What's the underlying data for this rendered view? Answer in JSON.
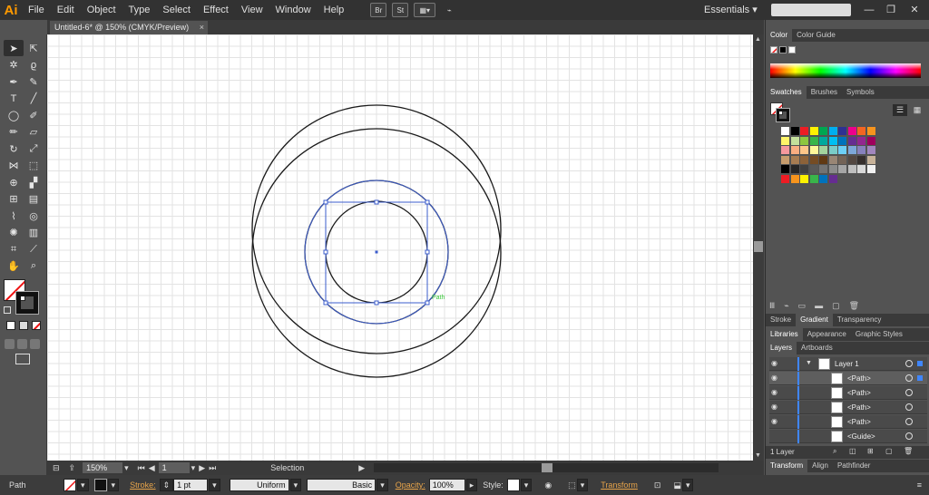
{
  "app": {
    "logo": "Ai",
    "workspace": "Essentials"
  },
  "menu": [
    "File",
    "Edit",
    "Object",
    "Type",
    "Select",
    "Effect",
    "View",
    "Window",
    "Help"
  ],
  "menubar_icons": [
    "br-icon",
    "st-icon",
    "arrange-icon",
    "gpu-icon"
  ],
  "menubar_icon_labels": [
    "Br",
    "St",
    "▦▾",
    "⌁"
  ],
  "window_controls": [
    "—",
    "❐",
    "✕"
  ],
  "document": {
    "tab_title": "Untitled-6* @ 150% (CMYK/Preview)",
    "close": "×"
  },
  "tools": [
    {
      "name": "selection-tool-icon",
      "glyph": "➤"
    },
    {
      "name": "direct-selection-tool-icon",
      "glyph": "⇱"
    },
    {
      "name": "magic-wand-tool-icon",
      "glyph": "✲"
    },
    {
      "name": "lasso-tool-icon",
      "glyph": "ϱ"
    },
    {
      "name": "pen-tool-icon",
      "glyph": "✒"
    },
    {
      "name": "curvature-tool-icon",
      "glyph": "✎"
    },
    {
      "name": "type-tool-icon",
      "glyph": "T"
    },
    {
      "name": "line-tool-icon",
      "glyph": "╱"
    },
    {
      "name": "ellipse-tool-icon",
      "glyph": "◯"
    },
    {
      "name": "paintbrush-tool-icon",
      "glyph": "✐"
    },
    {
      "name": "pencil-tool-icon",
      "glyph": "✏"
    },
    {
      "name": "eraser-tool-icon",
      "glyph": "▱"
    },
    {
      "name": "rotate-tool-icon",
      "glyph": "↻"
    },
    {
      "name": "scale-tool-icon",
      "glyph": "⤢"
    },
    {
      "name": "width-tool-icon",
      "glyph": "⋈"
    },
    {
      "name": "free-transform-tool-icon",
      "glyph": "⬚"
    },
    {
      "name": "shape-builder-tool-icon",
      "glyph": "⊕"
    },
    {
      "name": "perspective-grid-tool-icon",
      "glyph": "▞"
    },
    {
      "name": "mesh-tool-icon",
      "glyph": "⊞"
    },
    {
      "name": "gradient-tool-icon",
      "glyph": "▤"
    },
    {
      "name": "eyedropper-tool-icon",
      "glyph": "⌇"
    },
    {
      "name": "blend-tool-icon",
      "glyph": "◎"
    },
    {
      "name": "symbol-sprayer-tool-icon",
      "glyph": "✺"
    },
    {
      "name": "column-graph-tool-icon",
      "glyph": "▥"
    },
    {
      "name": "artboard-tool-icon",
      "glyph": "⌗"
    },
    {
      "name": "slice-tool-icon",
      "glyph": "⟋"
    },
    {
      "name": "hand-tool-icon",
      "glyph": "✋"
    },
    {
      "name": "zoom-tool-icon",
      "glyph": "⌕"
    }
  ],
  "canvas": {
    "selected_label": "Path",
    "handle_color": "#3b5ccc",
    "stroke_color": "#1a1a1a",
    "label_color": "#39c639"
  },
  "status": {
    "zoom": "150%",
    "artboard": "1",
    "tool": "Selection"
  },
  "control": {
    "selection_type": "Path",
    "stroke_label": "Stroke:",
    "stroke_weight": "1 pt",
    "profile": "Uniform",
    "brush": "Basic",
    "opacity_label": "Opacity:",
    "opacity": "100%",
    "style_label": "Style:",
    "transform_label": "Transform"
  },
  "panels": {
    "color_tabs": [
      "Color",
      "Color Guide"
    ],
    "swatch_tabs": [
      "Swatches",
      "Brushes",
      "Symbols"
    ],
    "stroke_tabs": [
      "Stroke",
      "Gradient",
      "Transparency"
    ],
    "library_tabs": [
      "Libraries",
      "Appearance",
      "Graphic Styles"
    ],
    "layer_tabs": [
      "Layers",
      "Artboards"
    ],
    "bottom_tabs": [
      "Transform",
      "Align",
      "Pathfinder"
    ],
    "layers": [
      {
        "name": "Layer 1",
        "indent": false
      },
      {
        "name": "<Path>",
        "indent": true
      },
      {
        "name": "<Path>",
        "indent": true
      },
      {
        "name": "<Path>",
        "indent": true
      },
      {
        "name": "<Path>",
        "indent": true
      },
      {
        "name": "<Guide>",
        "indent": true
      }
    ],
    "layers_count": "1 Layer"
  },
  "swatch_colors": [
    "#ffffff",
    "#000000",
    "#ed1c24",
    "#fff200",
    "#00a651",
    "#00aeef",
    "#2e3192",
    "#ec008c",
    "#f26522",
    "#f7941d",
    "#fff568",
    "#c4df9b",
    "#8dc63f",
    "#39b54a",
    "#00a99d",
    "#00bff3",
    "#0072bc",
    "#662d91",
    "#92278f",
    "#9e005d",
    "#f5989d",
    "#f9ad81",
    "#fdc689",
    "#fff799",
    "#a3d39c",
    "#7accc8",
    "#6dcff6",
    "#7da7d9",
    "#8781bd",
    "#a186be",
    "#c69c6d",
    "#a67c52",
    "#8c6239",
    "#754c24",
    "#603913",
    "#998675",
    "#736357",
    "#534741",
    "#362f2d",
    "#c7b299",
    "#000000",
    "#262626",
    "#404040",
    "#595959",
    "#737373",
    "#8c8c8c",
    "#a6a6a6",
    "#bfbfbf",
    "#d9d9d9",
    "#f2f2f2",
    "#ed1c24",
    "#f7941d",
    "#fff200",
    "#39b54a",
    "#0072bc",
    "#662d91"
  ]
}
